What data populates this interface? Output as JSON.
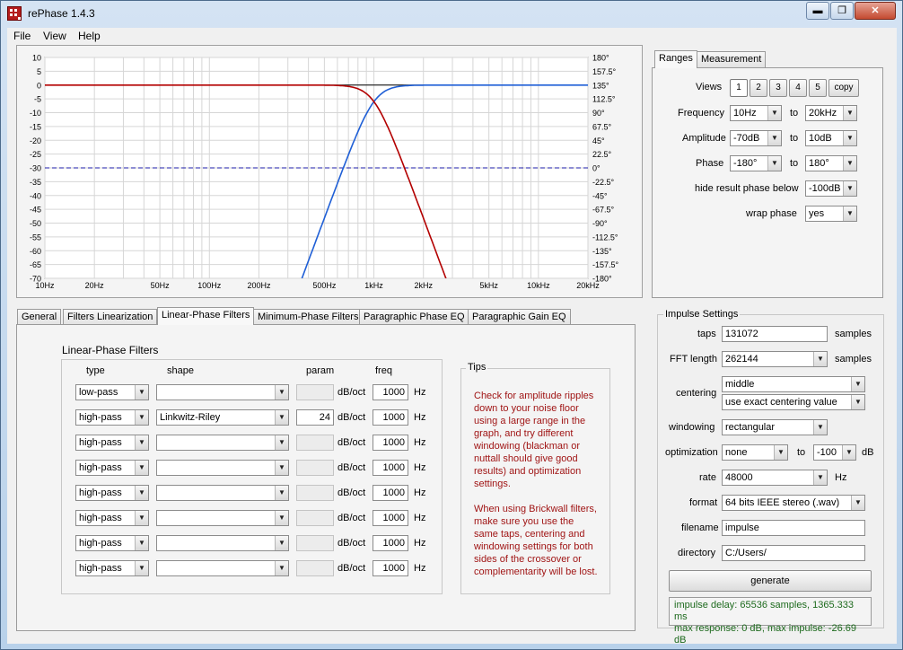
{
  "window": {
    "title": "rePhase 1.4.3",
    "minimize": "▬",
    "maximize": "❐",
    "close": "✕"
  },
  "menu": [
    "File",
    "View",
    "Help"
  ],
  "graph": {
    "left_ticks": [
      "10",
      "5",
      "0",
      "-5",
      "-10",
      "-15",
      "-20",
      "-25",
      "-30",
      "-35",
      "-40",
      "-45",
      "-50",
      "-55",
      "-60",
      "-65",
      "-70"
    ],
    "right_ticks": [
      "180°",
      "157.5°",
      "135°",
      "112.5°",
      "90°",
      "67.5°",
      "45°",
      "22.5°",
      "0°",
      "-22.5°",
      "-45°",
      "-67.5°",
      "-90°",
      "-112.5°",
      "-135°",
      "-157.5°",
      "-180°"
    ],
    "freq_ticks": [
      "10Hz",
      "20Hz",
      "50Hz",
      "100Hz",
      "200Hz",
      "500Hz",
      "1kHz",
      "2kHz",
      "5kHz",
      "10kHz",
      "20kHz"
    ],
    "colors": {
      "lowpass": "#b30000",
      "highpass": "#1f5fd6",
      "zero_line": "#000000",
      "phase_zero": "#1c1ca8"
    }
  },
  "right_tabs": [
    "Ranges",
    "Measurement"
  ],
  "ranges": {
    "views_label": "Views",
    "views": [
      "1",
      "2",
      "3",
      "4",
      "5",
      "copy"
    ],
    "frequency_label": "Frequency",
    "frequency_from": "10Hz",
    "frequency_to": "20kHz",
    "amplitude_label": "Amplitude",
    "amplitude_from": "-70dB",
    "amplitude_to": "10dB",
    "phase_label": "Phase",
    "phase_from": "-180°",
    "phase_to": "180°",
    "to": "to",
    "hide_label": "hide result phase below",
    "hide_value": "-100dB",
    "wrap_label": "wrap phase",
    "wrap_value": "yes"
  },
  "filter_tabs": [
    "General",
    "Filters Linearization",
    "Linear-Phase Filters",
    "Minimum-Phase Filters",
    "Paragraphic Phase EQ",
    "Paragraphic Gain EQ"
  ],
  "lp_filters": {
    "title": "Linear-Phase Filters",
    "headers": {
      "type": "type",
      "shape": "shape",
      "param": "param",
      "freq": "freq"
    },
    "unit_param": "dB/oct",
    "unit_freq": "Hz",
    "rows": [
      {
        "type": "low-pass",
        "shape": "",
        "param": "",
        "freq": "1000"
      },
      {
        "type": "high-pass",
        "shape": "Linkwitz-Riley",
        "param": "24",
        "freq": "1000"
      },
      {
        "type": "high-pass",
        "shape": "",
        "param": "",
        "freq": "1000"
      },
      {
        "type": "high-pass",
        "shape": "",
        "param": "",
        "freq": "1000"
      },
      {
        "type": "high-pass",
        "shape": "",
        "param": "",
        "freq": "1000"
      },
      {
        "type": "high-pass",
        "shape": "",
        "param": "",
        "freq": "1000"
      },
      {
        "type": "high-pass",
        "shape": "",
        "param": "",
        "freq": "1000"
      },
      {
        "type": "high-pass",
        "shape": "",
        "param": "",
        "freq": "1000"
      }
    ]
  },
  "tips": {
    "title": "Tips",
    "lines1": [
      "Check for amplitude ripples",
      "down to your noise floor",
      "using a large range in the",
      "graph, and try different",
      "windowing (blackman or",
      "nuttall should give good",
      "results) and optimization",
      "settings."
    ],
    "lines2": [
      "When using Brickwall filters,",
      "make sure you use the",
      "same taps, centering and",
      "windowing settings for both",
      "sides of the crossover or",
      "complementarity will be lost."
    ]
  },
  "impulse": {
    "title": "Impulse Settings",
    "taps_label": "taps",
    "taps_value": "131072",
    "samples": "samples",
    "fft_label": "FFT length",
    "fft_value": "262144",
    "centering_label": "centering",
    "centering_value": "middle",
    "centering_mode": "use exact centering value",
    "windowing_label": "windowing",
    "windowing_value": "rectangular",
    "optimization_label": "optimization",
    "optimization_value": "none",
    "opt_to": "to",
    "opt_db_value": "-100",
    "opt_db": "dB",
    "rate_label": "rate",
    "rate_value": "48000",
    "rate_unit": "Hz",
    "format_label": "format",
    "format_value": "64 bits IEEE stereo (.wav)",
    "filename_label": "filename",
    "filename_value": "impulse",
    "directory_label": "directory",
    "directory_value": "C:/Users/",
    "generate": "generate",
    "status1": "impulse delay: 65536 samples, 1365.333 ms",
    "status2": "max response: 0 dB, max impulse: -26.69 dB"
  }
}
